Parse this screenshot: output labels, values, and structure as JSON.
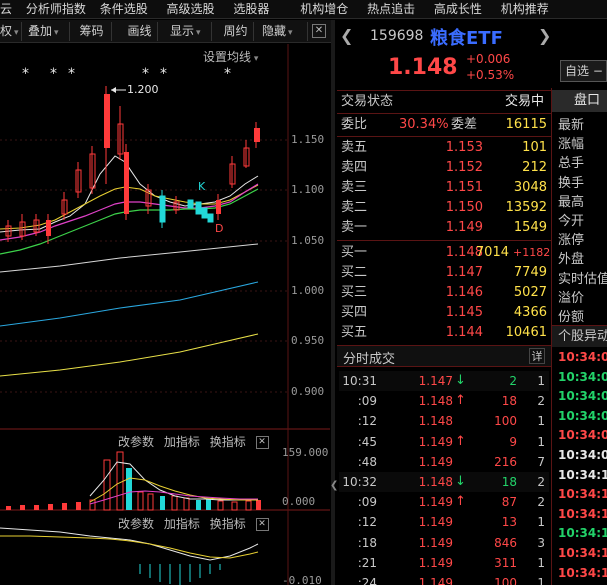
{
  "top_menu": [
    "云",
    "分析师指数",
    "条件选股",
    "高级选股",
    "选股器",
    "机构增仓",
    "热点追击",
    "高成长性",
    "机构推荐"
  ],
  "toolbar": {
    "items": [
      "权",
      "叠加",
      "筹码",
      "画线",
      "显示",
      "周约",
      "隐藏"
    ],
    "close_glyph": "✕",
    "ma_settings": "设置均线"
  },
  "chart": {
    "high_label": "1.200",
    "star_marks": [
      "*",
      "*",
      "*",
      "*",
      "*",
      "*"
    ],
    "k_mark": "K",
    "d_mark": "D",
    "y_labels": [
      "1.150",
      "1.100",
      "1.050",
      "1.000",
      "0.950",
      "0.900"
    ],
    "vol_y_labels": [
      "159.000",
      "0.000"
    ],
    "macd_y_label": "-0.010"
  },
  "indicator_bar": {
    "change_params": "改参数",
    "add_indicator": "加指标",
    "switch_indicator": "换指标"
  },
  "quote": {
    "code": "159698",
    "name": "粮食ETF",
    "price": "1.148",
    "change": "+0.006",
    "change_pct": "+0.53%",
    "watchlist_button": "自选 −"
  },
  "trade_status": {
    "label": "交易状态",
    "value": "交易中"
  },
  "ratio": {
    "label": "委比",
    "value": "30.34%",
    "diff_label": "委差",
    "diff_value": "16115"
  },
  "asks": [
    {
      "label": "卖五",
      "price": "1.153",
      "volume": "101"
    },
    {
      "label": "卖四",
      "price": "1.152",
      "volume": "212"
    },
    {
      "label": "卖三",
      "price": "1.151",
      "volume": "3048"
    },
    {
      "label": "卖二",
      "price": "1.150",
      "volume": "13592"
    },
    {
      "label": "卖一",
      "price": "1.149",
      "volume": "1549"
    }
  ],
  "bids": [
    {
      "label": "买一",
      "price": "1.148",
      "volume": "7014",
      "change": "+1182"
    },
    {
      "label": "买二",
      "price": "1.147",
      "volume": "7749",
      "change": ""
    },
    {
      "label": "买三",
      "price": "1.146",
      "volume": "5027",
      "change": ""
    },
    {
      "label": "买四",
      "price": "1.145",
      "volume": "4366",
      "change": ""
    },
    {
      "label": "买五",
      "price": "1.144",
      "volume": "10461",
      "change": ""
    }
  ],
  "ticks_header": {
    "title": "分时成交",
    "detail": "详"
  },
  "ticks": [
    {
      "time": "10:31",
      "price": "1.147",
      "dir": "down",
      "volume": "2",
      "count": "1"
    },
    {
      "time": ":09",
      "price": "1.148",
      "dir": "up",
      "volume": "18",
      "count": "2"
    },
    {
      "time": ":12",
      "price": "1.148",
      "dir": "",
      "volume": "100",
      "count": "1"
    },
    {
      "time": ":45",
      "price": "1.149",
      "dir": "up",
      "volume": "9",
      "count": "1"
    },
    {
      "time": ":48",
      "price": "1.149",
      "dir": "",
      "volume": "216",
      "count": "7"
    },
    {
      "time": "10:32",
      "price": "1.148",
      "dir": "down",
      "volume": "18",
      "count": "2"
    },
    {
      "time": ":09",
      "price": "1.149",
      "dir": "up",
      "volume": "87",
      "count": "2"
    },
    {
      "time": ":12",
      "price": "1.149",
      "dir": "",
      "volume": "13",
      "count": "1"
    },
    {
      "time": ":18",
      "price": "1.149",
      "dir": "",
      "volume": "846",
      "count": "3"
    },
    {
      "time": ":21",
      "price": "1.149",
      "dir": "",
      "volume": "311",
      "count": "1"
    },
    {
      "time": ":24",
      "price": "1.149",
      "dir": "",
      "volume": "100",
      "count": "1"
    }
  ],
  "right_tabs": {
    "active": "盘口"
  },
  "stats_labels": [
    "最新",
    "涨幅",
    "总手",
    "换手",
    "最高",
    "今开",
    "涨停",
    "外盘",
    "实时估值",
    "溢价",
    "份额"
  ],
  "alerts": {
    "title": "个股异动",
    "times": [
      {
        "time": "10:34:0",
        "color": "#ff4848"
      },
      {
        "time": "10:34:0",
        "color": "#22d36a"
      },
      {
        "time": "10:34:0",
        "color": "#22d36a"
      },
      {
        "time": "10:34:0",
        "color": "#22d36a"
      },
      {
        "time": "10:34:0",
        "color": "#ff4848"
      },
      {
        "time": "10:34:0",
        "color": "#e8e8e8"
      },
      {
        "time": "10:34:1",
        "color": "#e8e8e8"
      },
      {
        "time": "10:34:1",
        "color": "#ff4848"
      },
      {
        "time": "10:34:1",
        "color": "#ff4848"
      },
      {
        "time": "10:34:1",
        "color": "#22d36a"
      },
      {
        "time": "10:34:1",
        "color": "#ff4848"
      },
      {
        "time": "10:34:1",
        "color": "#ff4848"
      }
    ]
  }
}
